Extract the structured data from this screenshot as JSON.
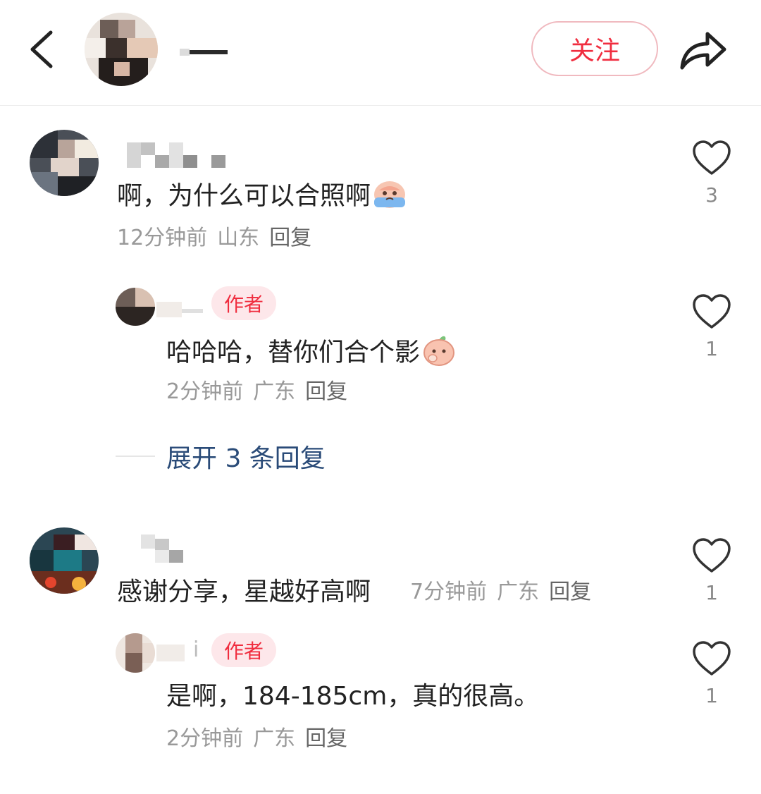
{
  "header": {
    "follow_label": "关注"
  },
  "comments": [
    {
      "text": "啊，为什么可以合照啊",
      "emoji": "crying-emoji",
      "time": "12分钟前",
      "location": "山东",
      "reply_label": "回复",
      "likes": "3",
      "replies": [
        {
          "badge": "作者",
          "text": "哈哈哈，替你们合个影",
          "emoji": "peach-smile-emoji",
          "time": "2分钟前",
          "location": "广东",
          "reply_label": "回复",
          "likes": "1"
        }
      ],
      "expand_label": "展开 3 条回复"
    },
    {
      "text": "感谢分享，星越好高啊",
      "time": "7分钟前",
      "location": "广东",
      "reply_label": "回复",
      "likes": "1",
      "replies": [
        {
          "badge": "作者",
          "name_suffix": "i",
          "text": "是啊，184-185cm，真的很高。",
          "time": "2分钟前",
          "location": "广东",
          "reply_label": "回复",
          "likes": "1"
        }
      ]
    }
  ],
  "colors": {
    "accent_red": "#f02d3f",
    "badge_bg": "#fde7ea",
    "expand_blue": "#2a4b78"
  },
  "icons": [
    "back-arrow-icon",
    "share-icon",
    "heart-icon"
  ]
}
